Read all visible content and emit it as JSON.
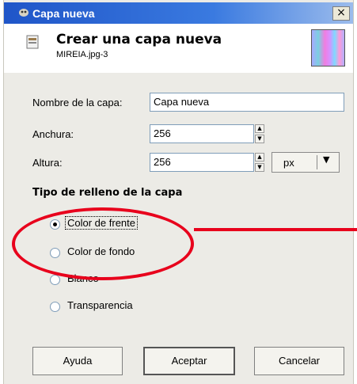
{
  "window": {
    "title": "Capa nueva",
    "close_label": "×"
  },
  "header": {
    "title": "Crear una capa nueva",
    "subtitle": "MIREIA.jpg-3"
  },
  "form": {
    "name_label": "Nombre de la capa:",
    "name_value": "Capa nueva",
    "width_label": "Anchura:",
    "width_value": "256",
    "height_label": "Altura:",
    "height_value": "256",
    "unit_value": "px"
  },
  "fill": {
    "title": "Tipo de relleno de la capa",
    "options": [
      {
        "label": "Color de frente",
        "selected": true
      },
      {
        "label": "Color de fondo",
        "selected": false
      },
      {
        "label": "Blanco",
        "selected": false
      },
      {
        "label": "Transparencia",
        "selected": false
      }
    ]
  },
  "buttons": {
    "help": "Ayuda",
    "ok": "Aceptar",
    "cancel": "Cancelar"
  },
  "annotation": {
    "color": "#e8001c"
  }
}
